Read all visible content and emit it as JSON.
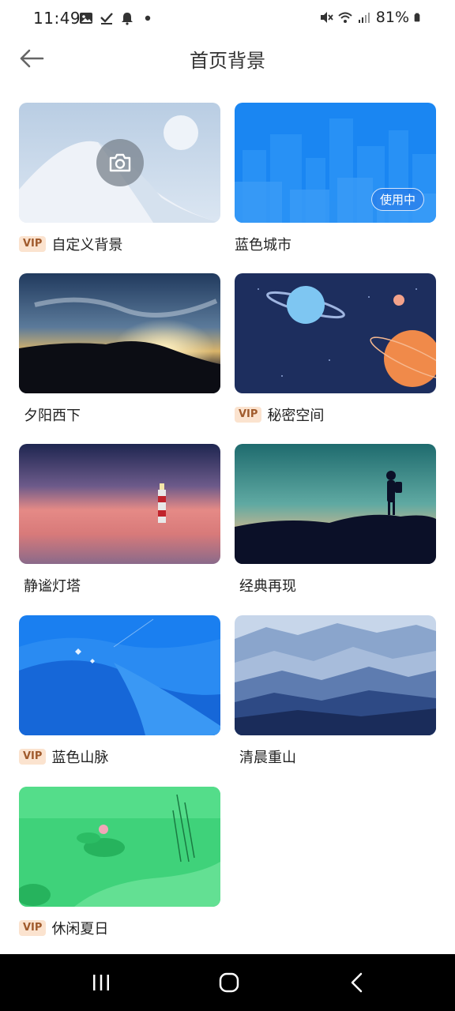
{
  "status_bar": {
    "time": "11:49",
    "battery": "81%",
    "left_icons": [
      "image-icon",
      "check-icon",
      "bell-icon",
      "dot-icon"
    ],
    "right_icons": [
      "mute-icon",
      "wifi-icon",
      "signal-icon",
      "battery-icon"
    ]
  },
  "header": {
    "title": "首页背景",
    "back_icon": "arrow-left-icon"
  },
  "backgrounds": [
    {
      "label": "自定义背景",
      "vip": "VIP",
      "art": "custom",
      "camera_icon": "camera-icon"
    },
    {
      "label": "蓝色城市",
      "in_use": "使用中",
      "art": "city"
    },
    {
      "label": "夕阳西下",
      "art": "sunset"
    },
    {
      "label": "秘密空间",
      "vip": "VIP",
      "art": "space"
    },
    {
      "label": "静谧灯塔",
      "art": "lighthouse"
    },
    {
      "label": "经典再现",
      "art": "classic"
    },
    {
      "label": "蓝色山脉",
      "vip": "VIP",
      "art": "mountain"
    },
    {
      "label": "清晨重山",
      "art": "mist"
    },
    {
      "label": "休闲夏日",
      "vip": "VIP",
      "art": "summer"
    }
  ],
  "nav_bar": {
    "recent_icon": "recent-apps-icon",
    "home_icon": "home-icon",
    "back_icon": "nav-back-icon"
  },
  "colors": {
    "vip_bg": "#fbe3cf",
    "vip_text": "#a05a2c",
    "accent_blue": "#1a7ff0"
  }
}
